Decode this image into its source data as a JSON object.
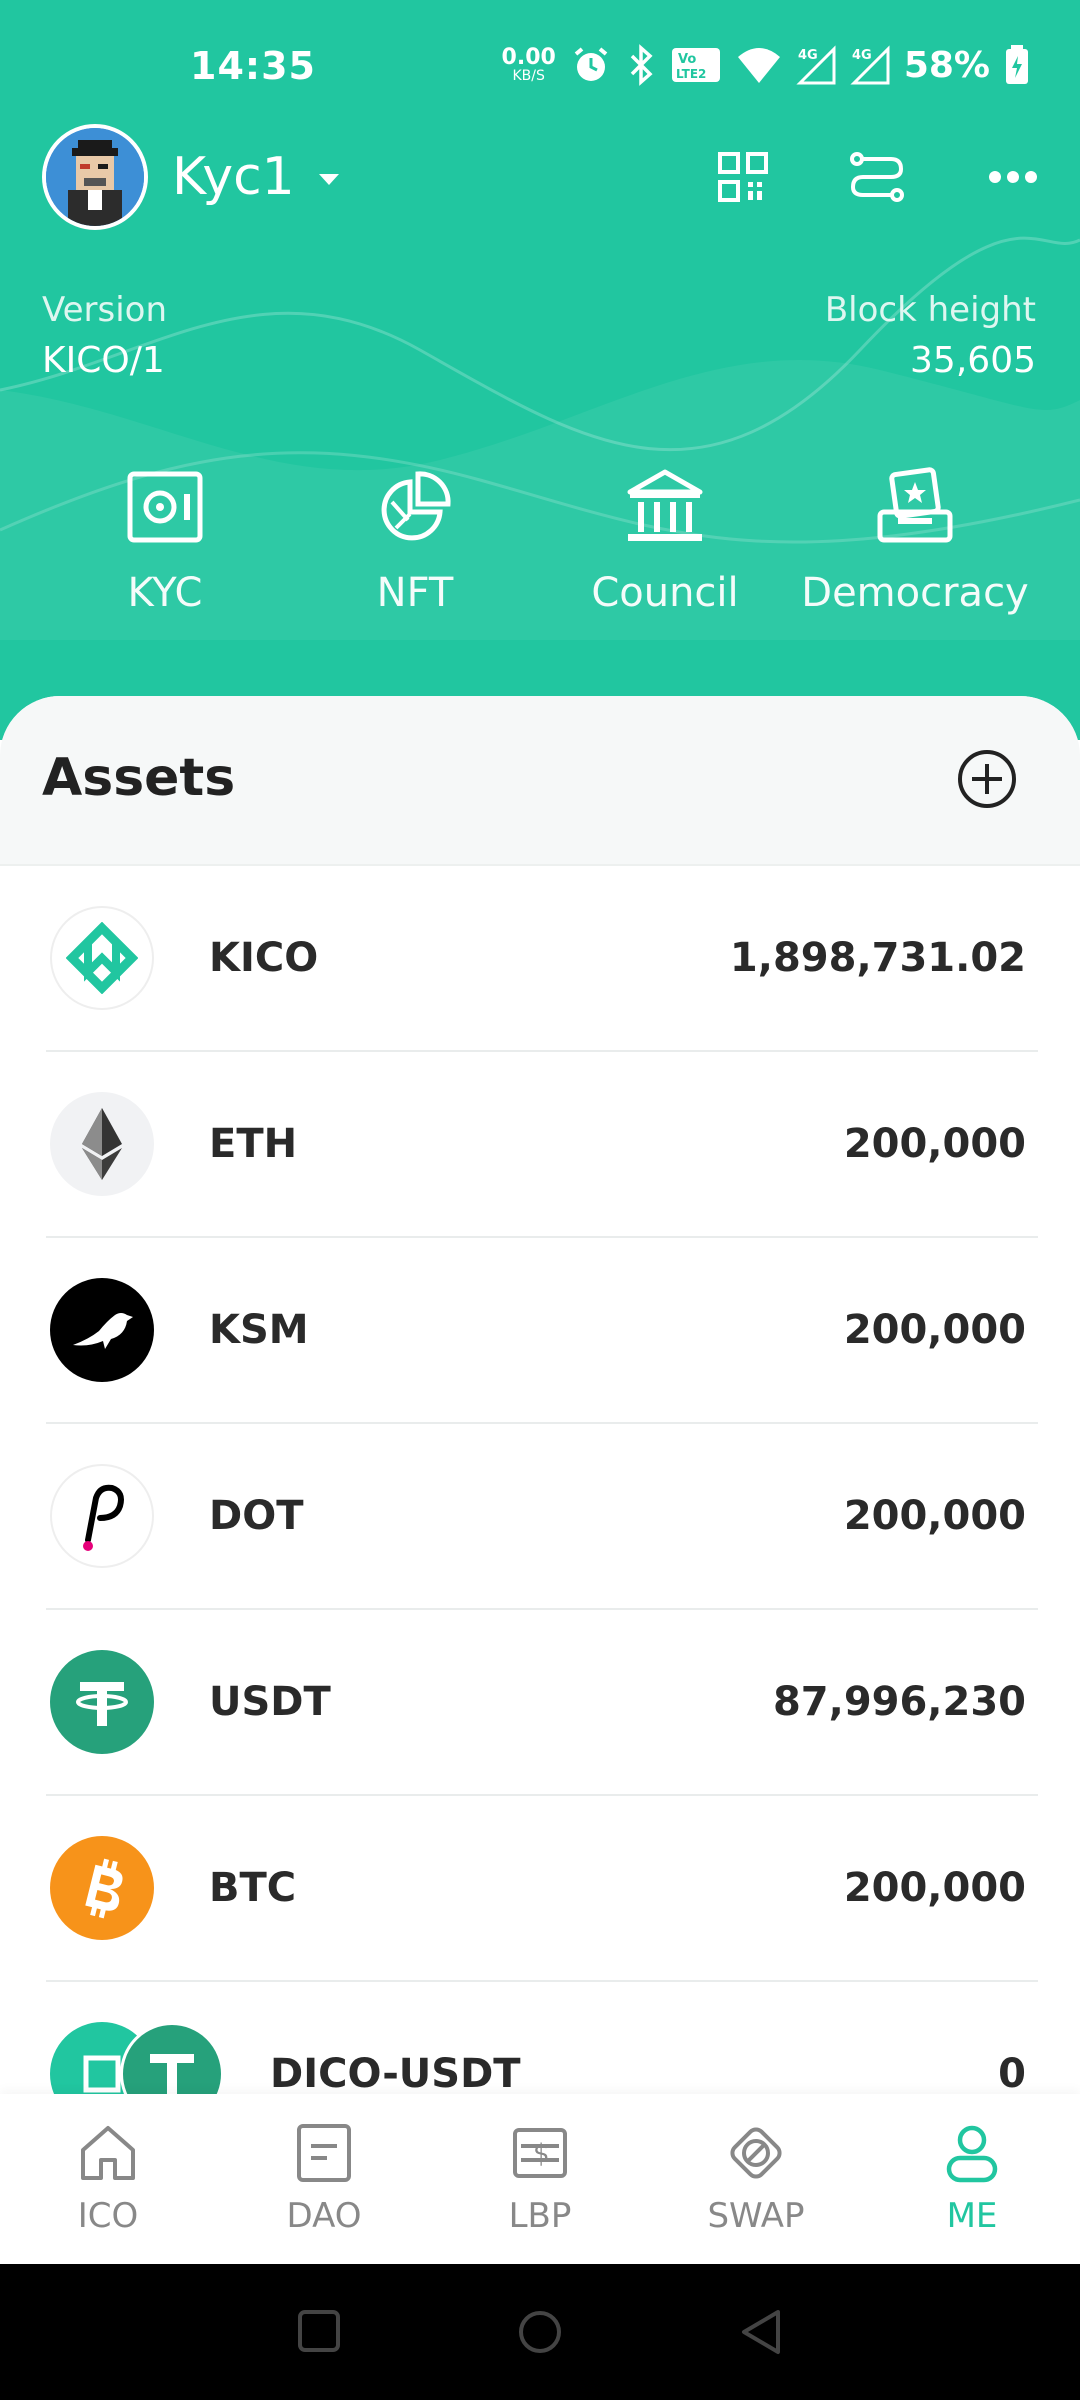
{
  "status_bar": {
    "time": "14:35",
    "net_speed_value": "0.00",
    "net_speed_unit": "KB/S",
    "network_badge": "4G",
    "battery": "58%",
    "icons": [
      "alarm-icon",
      "bluetooth-icon",
      "volte-icon",
      "wifi-icon",
      "signal-icon",
      "battery-icon"
    ]
  },
  "header": {
    "account_name": "Kyc1",
    "icons": [
      "qr-code-icon",
      "transfer-icon",
      "more-icon"
    ]
  },
  "chain_info": {
    "version_label": "Version",
    "version_value": "KICO/1",
    "block_label": "Block height",
    "block_value": "35,605"
  },
  "quick_actions": [
    {
      "label": "KYC",
      "icon": "kyc-icon"
    },
    {
      "label": "NFT",
      "icon": "nft-pie-icon"
    },
    {
      "label": "Council",
      "icon": "council-building-icon"
    },
    {
      "label": "Democracy",
      "icon": "democracy-icon"
    }
  ],
  "assets": {
    "title": "Assets",
    "items": [
      {
        "symbol": "KICO",
        "balance": "1,898,731.02"
      },
      {
        "symbol": "ETH",
        "balance": "200,000"
      },
      {
        "symbol": "KSM",
        "balance": "200,000"
      },
      {
        "symbol": "DOT",
        "balance": "200,000"
      },
      {
        "symbol": "USDT",
        "balance": "87,996,230"
      },
      {
        "symbol": "BTC",
        "balance": "200,000"
      },
      {
        "symbol": "DICO-USDT",
        "balance": "0"
      }
    ]
  },
  "bottom_nav": [
    {
      "label": "ICO",
      "active": false
    },
    {
      "label": "DAO",
      "active": false
    },
    {
      "label": "LBP",
      "active": false
    },
    {
      "label": "SWAP",
      "active": false
    },
    {
      "label": "ME",
      "active": true
    }
  ],
  "colors": {
    "brand": "#21c6a0",
    "usdt": "#26a17b",
    "btc": "#f7931a",
    "dot_accent": "#e6007a"
  }
}
